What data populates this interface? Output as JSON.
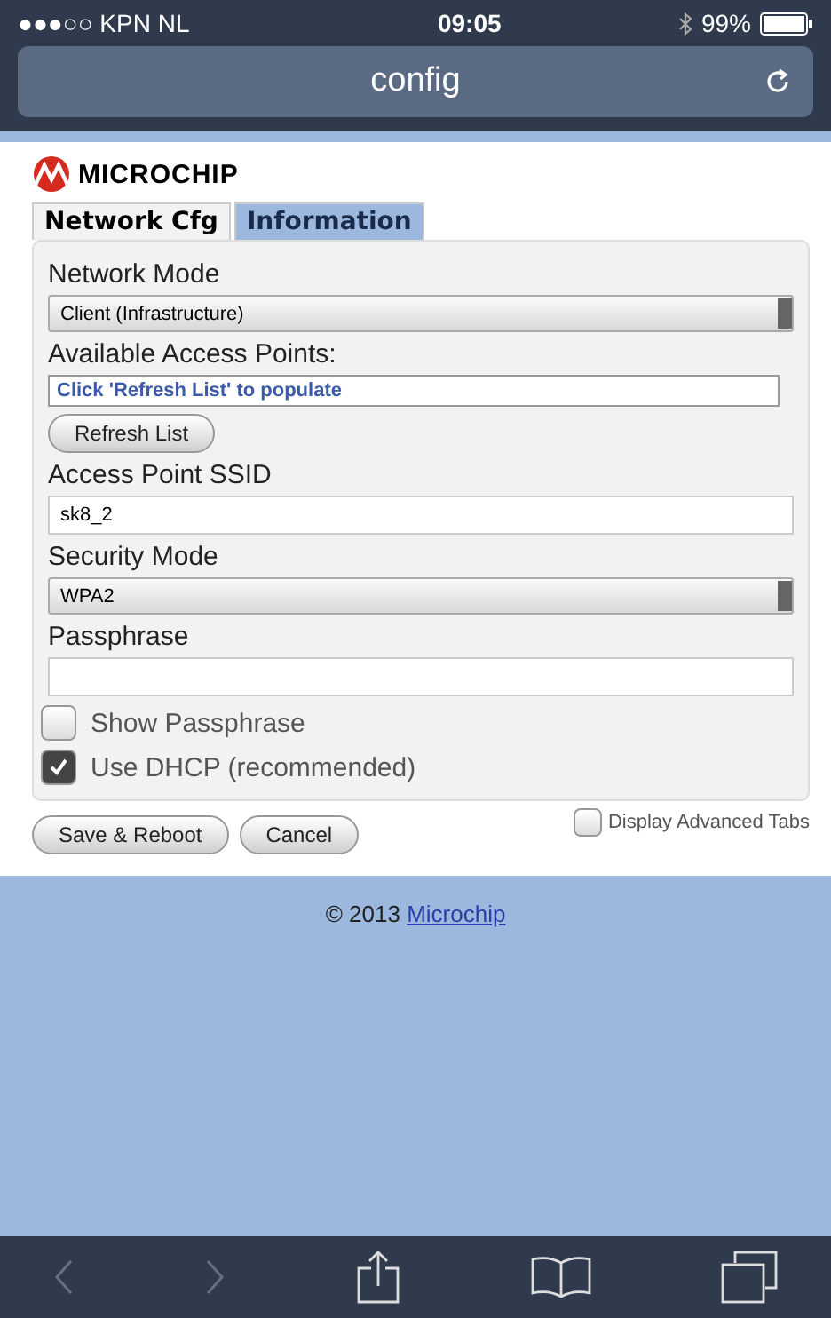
{
  "status_bar": {
    "carrier": "●●●○○ KPN NL",
    "time": "09:05",
    "battery": "99%"
  },
  "address_bar": {
    "title": "config"
  },
  "logo": {
    "text": "MICROCHIP"
  },
  "tabs": [
    {
      "label": "Network Cfg",
      "selected": true
    },
    {
      "label": "Information",
      "selected": false
    }
  ],
  "fields": [
    {
      "kind": "select",
      "label": "Network Mode",
      "value": "Client (Infrastructure)"
    },
    {
      "kind": "list",
      "label": "Available Access Points:",
      "value": "Click 'Refresh List' to populate",
      "button": "Refresh List"
    },
    {
      "kind": "input",
      "label": "Access Point SSID",
      "value": "sk8_2"
    },
    {
      "kind": "select",
      "label": "Security Mode",
      "value": "WPA2"
    },
    {
      "kind": "input",
      "label": "Passphrase"
    }
  ],
  "checkboxes": [
    {
      "label": "Show Passphrase",
      "checked": false
    },
    {
      "label": "Use DHCP (recommended)",
      "checked": true
    }
  ],
  "buttons": [
    "Save & Reboot",
    "Cancel"
  ],
  "advanced": {
    "label": "Display Advanced Tabs",
    "checked": false
  },
  "footer": {
    "text": "© 2013",
    "link": "Microchip"
  }
}
